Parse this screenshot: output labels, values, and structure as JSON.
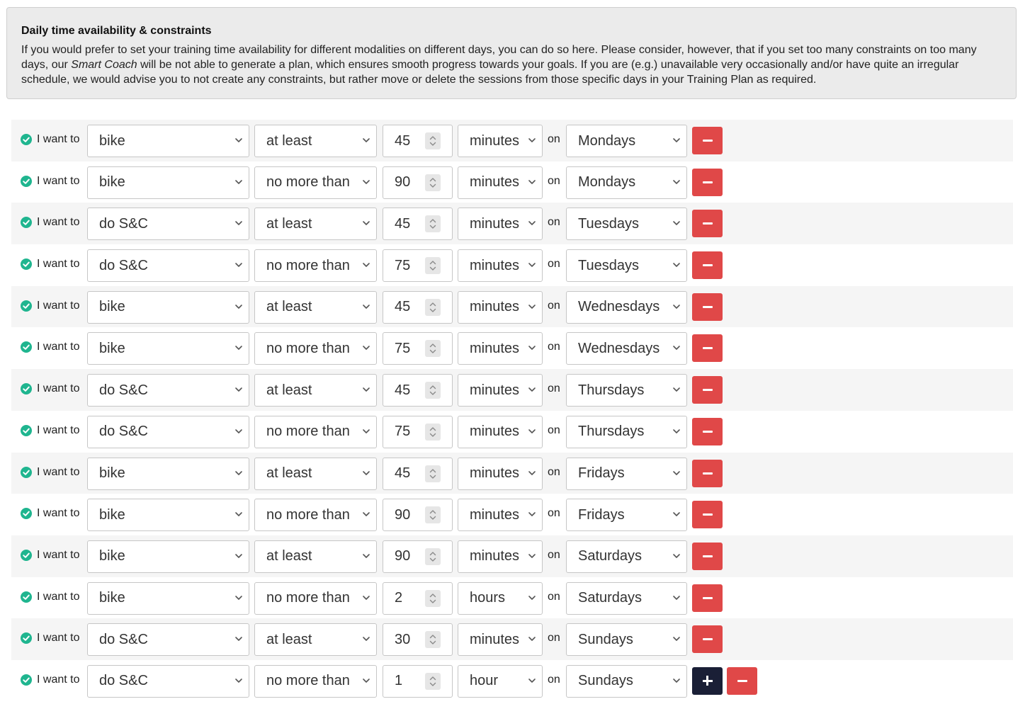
{
  "info": {
    "title": "Daily time availability & constraints",
    "text_before": "If you would prefer to set your training time availability for different modalities on different days, you can do so here. Please consider, however, that if you set too many constraints on too many days, our ",
    "text_em": "Smart Coach",
    "text_after": " will be not able to generate a plan, which ensures smooth progress towards your goals. If you are (e.g.) unavailable very occasionally and/or have quite an irregular schedule, we would advise you to not create any constraints, but rather move or delete the sessions from those specific days in your Training Plan as required."
  },
  "labels": {
    "i_want_to": "I want to",
    "on": "on"
  },
  "colors": {
    "check": "#1fb58f",
    "remove": "#e04848",
    "add": "#1a1f36"
  },
  "rows": [
    {
      "activity": "bike",
      "comparison": "at least",
      "amount": "45",
      "unit": "minutes",
      "day": "Mondays"
    },
    {
      "activity": "bike",
      "comparison": "no more than",
      "amount": "90",
      "unit": "minutes",
      "day": "Mondays"
    },
    {
      "activity": "do S&C",
      "comparison": "at least",
      "amount": "45",
      "unit": "minutes",
      "day": "Tuesdays"
    },
    {
      "activity": "do S&C",
      "comparison": "no more than",
      "amount": "75",
      "unit": "minutes",
      "day": "Tuesdays"
    },
    {
      "activity": "bike",
      "comparison": "at least",
      "amount": "45",
      "unit": "minutes",
      "day": "Wednesdays"
    },
    {
      "activity": "bike",
      "comparison": "no more than",
      "amount": "75",
      "unit": "minutes",
      "day": "Wednesdays"
    },
    {
      "activity": "do S&C",
      "comparison": "at least",
      "amount": "45",
      "unit": "minutes",
      "day": "Thursdays"
    },
    {
      "activity": "do S&C",
      "comparison": "no more than",
      "amount": "75",
      "unit": "minutes",
      "day": "Thursdays"
    },
    {
      "activity": "bike",
      "comparison": "at least",
      "amount": "45",
      "unit": "minutes",
      "day": "Fridays"
    },
    {
      "activity": "bike",
      "comparison": "no more than",
      "amount": "90",
      "unit": "minutes",
      "day": "Fridays"
    },
    {
      "activity": "bike",
      "comparison": "at least",
      "amount": "90",
      "unit": "minutes",
      "day": "Saturdays"
    },
    {
      "activity": "bike",
      "comparison": "no more than",
      "amount": "2",
      "unit": "hours",
      "day": "Saturdays"
    },
    {
      "activity": "do S&C",
      "comparison": "at least",
      "amount": "30",
      "unit": "minutes",
      "day": "Sundays"
    },
    {
      "activity": "do S&C",
      "comparison": "no more than",
      "amount": "1",
      "unit": "hour",
      "day": "Sundays"
    }
  ]
}
